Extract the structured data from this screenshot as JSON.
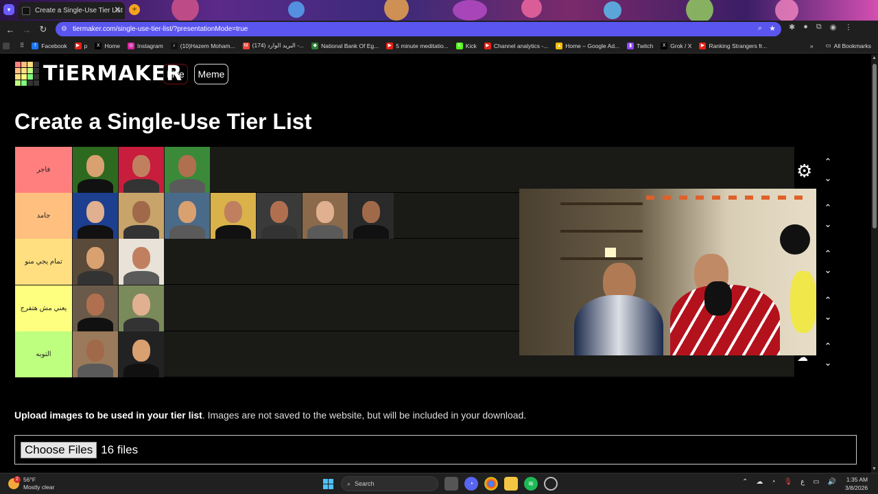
{
  "browser": {
    "tab_title": "Create a Single-Use Tier List (Pr",
    "tab_close": "✕",
    "new_tab": "+",
    "url": "tiermaker.com/single-use-tier-list/?presentationMode=true",
    "bookmarks": [
      {
        "label": "Facebook",
        "color": "#1877f2",
        "glyph": "f"
      },
      {
        "label": "p",
        "color": "#e62117",
        "glyph": "▶"
      },
      {
        "label": "Home",
        "color": "#000000",
        "glyph": "X"
      },
      {
        "label": "Instagram",
        "color": "#d6249f",
        "glyph": "◎"
      },
      {
        "label": "(10)Hazem Moham...",
        "color": "#111111",
        "glyph": "♪"
      },
      {
        "label": "(174) البريد الوارد -...",
        "color": "#ea4335",
        "glyph": "M"
      },
      {
        "label": "National Bank Of Eg...",
        "color": "#2e7d32",
        "glyph": "◆"
      },
      {
        "label": "5 minute meditatio...",
        "color": "#e62117",
        "glyph": "▶"
      },
      {
        "label": "Kick",
        "color": "#53fc18",
        "glyph": "K"
      },
      {
        "label": "Channel analytics -...",
        "color": "#e62117",
        "glyph": "▶"
      },
      {
        "label": "Home – Google Ad...",
        "color": "#fbbc04",
        "glyph": "▲"
      },
      {
        "label": "Twitch",
        "color": "#9146ff",
        "glyph": "▮"
      },
      {
        "label": "Grok / X",
        "color": "#000000",
        "glyph": "X"
      },
      {
        "label": "Ranking Strangers fr...",
        "color": "#e62117",
        "glyph": "▶"
      }
    ],
    "all_bookmarks": "All Bookmarks"
  },
  "site": {
    "logo": "TiERMAKER",
    "live_label": "Live",
    "meme_label": "Meme",
    "page_title": "Create a Single-Use Tier List"
  },
  "tiers": [
    {
      "label": "فاجر",
      "color": "#ff7f7f",
      "count": 3
    },
    {
      "label": "جامد",
      "color": "#ffbf7f",
      "count": 7
    },
    {
      "label": "تمام يجي منو",
      "color": "#ffdf7f",
      "count": 2
    },
    {
      "label": "يعني مش هتفرج",
      "color": "#ffff7f",
      "count": 2
    },
    {
      "label": "التوبه",
      "color": "#bfff7f",
      "count": 2
    }
  ],
  "upload": {
    "bold_text": "Upload images to be used in your tier list",
    "rest_text": ". Images are not saved to the website, but will be included in your download.",
    "choose_label": "Choose Files",
    "file_count": "16 files"
  },
  "taskbar": {
    "temp": "56°F",
    "condition": "Mostly clear",
    "weather_badge": "2",
    "search_placeholder": "Search",
    "time": "1:35 AM",
    "date": "3/8/2026",
    "lang": "ع"
  }
}
